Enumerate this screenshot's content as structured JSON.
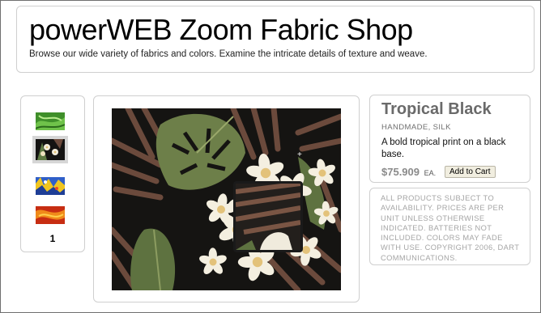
{
  "header": {
    "title": "powerWEB Zoom Fabric Shop",
    "subtitle": "Browse our wide variety of fabrics and colors. Examine the intricate details of texture and weave."
  },
  "thumbnails": {
    "items": [
      {
        "name": "green-fabric-thumbnail",
        "selected": false
      },
      {
        "name": "tropical-black-fabric-thumbnail",
        "selected": true
      },
      {
        "name": "blue-yellow-fabric-thumbnail",
        "selected": false
      },
      {
        "name": "orange-red-fabric-thumbnail",
        "selected": false
      }
    ],
    "page_number": "1"
  },
  "product": {
    "name": "Tropical Black",
    "meta": "HANDMADE, SILK",
    "description": "A bold tropical print on a black base.",
    "price": "$75.909",
    "price_unit": "EA.",
    "add_to_cart_label": "Add to Cart"
  },
  "notice": {
    "text": "ALL PRODUCTS SUBJECT TO AVAILABILITY. PRICES ARE PER UNIT UNLESS OTHERWISE INDICATED. BATTERIES NOT INCLUDED. COLORS MAY FADE WITH USE. COPYRIGHT 2006, DART COMMUNICATIONS."
  },
  "colors": {
    "fabric_base": "#151412",
    "leaf_green": "#6d7f49",
    "leaf_brown": "#6b4a3c",
    "flower_white": "#f4efe0",
    "flower_center": "#e3c27a"
  },
  "icons": {
    "zoom_handle": "crosshair-icon"
  }
}
